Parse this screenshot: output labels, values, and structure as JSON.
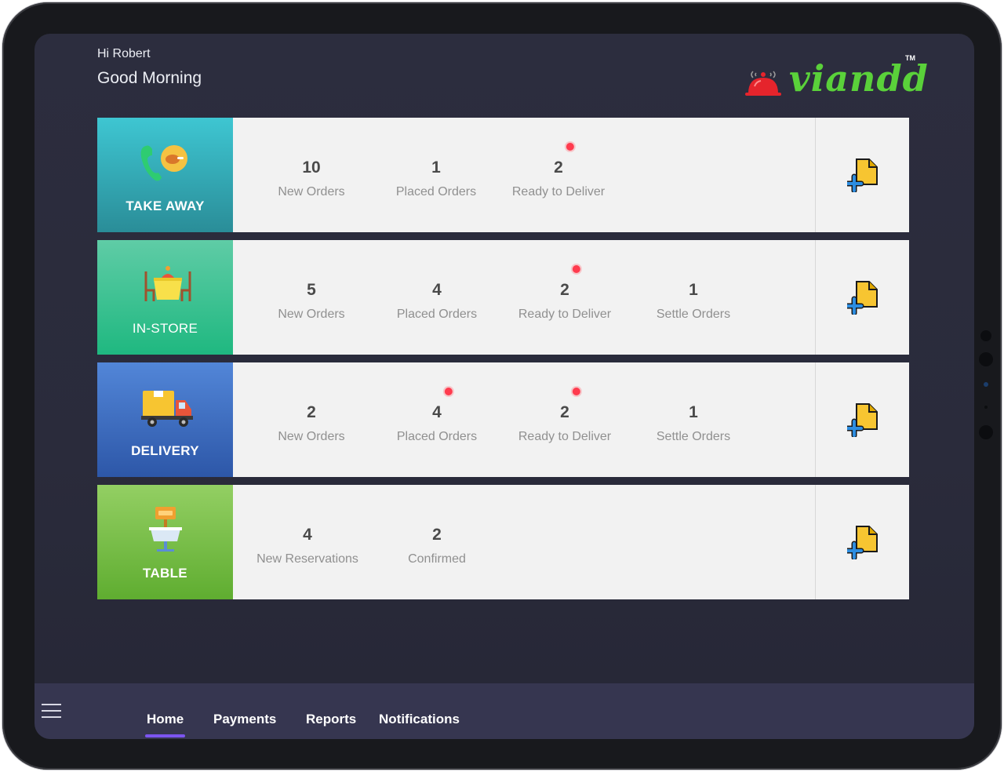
{
  "header": {
    "greeting": "Hi Robert",
    "salutation": "Good Morning"
  },
  "brand": {
    "name": "viandd",
    "trademark": "TM",
    "color": "#5ad13a",
    "icon": "cloche-icon"
  },
  "categories": [
    {
      "label": "TAKE AWAY",
      "icon": "phone-chicken-icon",
      "gradient": [
        "#3ec6d2",
        "#2a8d98"
      ],
      "stats": [
        {
          "value": "10",
          "label": "New Orders",
          "alert": false
        },
        {
          "value": "1",
          "label": "Placed Orders",
          "alert": false
        },
        {
          "value": "2",
          "label": "Ready to Deliver",
          "alert": true
        }
      ]
    },
    {
      "label": "IN-STORE",
      "icon": "dining-table-icon",
      "gradient": [
        "#5fcca6",
        "#1fb880"
      ],
      "stats": [
        {
          "value": "5",
          "label": "New Orders",
          "alert": false
        },
        {
          "value": "4",
          "label": "Placed Orders",
          "alert": false
        },
        {
          "value": "2",
          "label": "Ready to Deliver",
          "alert": true
        },
        {
          "value": "1",
          "label": "Settle Orders",
          "alert": false
        }
      ]
    },
    {
      "label": "DELIVERY",
      "icon": "delivery-truck-icon",
      "gradient": [
        "#5286d8",
        "#2d57a8"
      ],
      "stats": [
        {
          "value": "2",
          "label": "New Orders",
          "alert": false
        },
        {
          "value": "4",
          "label": "Placed Orders",
          "alert": true
        },
        {
          "value": "2",
          "label": "Ready to Deliver",
          "alert": true
        },
        {
          "value": "1",
          "label": "Settle Orders",
          "alert": false
        }
      ]
    },
    {
      "label": "TABLE",
      "icon": "reserved-table-icon",
      "gradient": [
        "#93cf63",
        "#5fad30"
      ],
      "stats": [
        {
          "value": "4",
          "label": "New Reservations",
          "alert": false
        },
        {
          "value": "2",
          "label": "Confirmed",
          "alert": false
        }
      ]
    }
  ],
  "add_action": {
    "icon": "add-document-icon"
  },
  "nav": {
    "menu_icon": "hamburger-menu-icon",
    "items": [
      {
        "label": "Home",
        "active": true
      },
      {
        "label": "Payments",
        "active": false
      },
      {
        "label": "Reports",
        "active": false
      },
      {
        "label": "Notifications",
        "active": false
      }
    ],
    "active_color": "#7c55f0"
  }
}
